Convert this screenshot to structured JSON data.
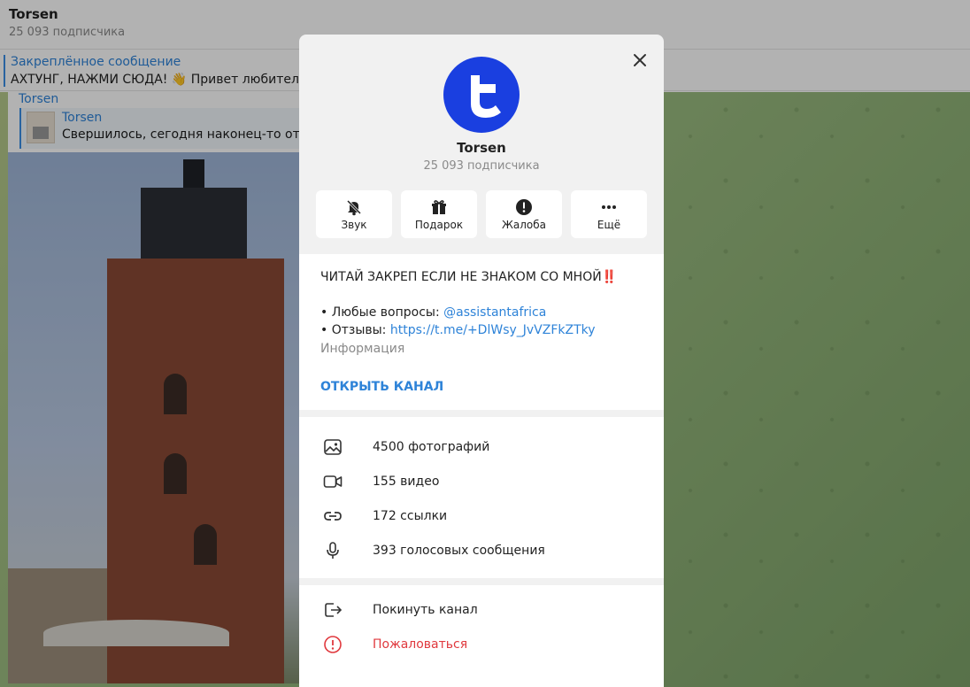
{
  "chat": {
    "title": "Torsen",
    "subscribers": "25 093 подписчика",
    "pinned_title": "Закреплённое сообщение",
    "pinned_text": "АХТУНГ, НАЖМИ СЮДА! 👋 Привет любителям … анца.  Почему Африканец? Все просто, после ск..."
  },
  "message": {
    "author": "Torsen",
    "reply_name": "Torsen",
    "reply_text": "Свершилось, сегодня наконец-то отчал"
  },
  "modal": {
    "name": "Torsen",
    "subscribers": "25 093 подписчика",
    "avatar_letter": "t",
    "accent": "#1a3fe0",
    "actions": [
      {
        "icon": "bell-off-icon",
        "label": "Звук"
      },
      {
        "icon": "gift-icon",
        "label": "Подарок"
      },
      {
        "icon": "alert-circle-icon",
        "label": "Жалоба"
      },
      {
        "icon": "more-icon",
        "label": "Ещё"
      }
    ],
    "info": {
      "headline": "ЧИТАЙ ЗАКРЕП ЕСЛИ НЕ ЗНАКОМ СО МНОЙ‼️",
      "questions_prefix": "• Любые вопросы: ",
      "questions_link": "@assistantafrica",
      "reviews_prefix": "• Отзывы: ",
      "reviews_link": "https://t.me/+DlWsy_JvVZFkZTky",
      "caption": "Информация",
      "open_channel": "ОТКРЫТЬ КАНАЛ"
    },
    "media": [
      {
        "icon": "photo-icon",
        "label": "4500 фотографий"
      },
      {
        "icon": "video-icon",
        "label": "155 видео"
      },
      {
        "icon": "link-icon",
        "label": "172 ссылки"
      },
      {
        "icon": "microphone-icon",
        "label": "393 голосовых сообщения"
      }
    ],
    "leave": {
      "icon": "leave-icon",
      "label": "Покинуть канал"
    },
    "report": {
      "icon": "report-icon",
      "label": "Пожаловаться",
      "color": "#e0393e"
    }
  }
}
